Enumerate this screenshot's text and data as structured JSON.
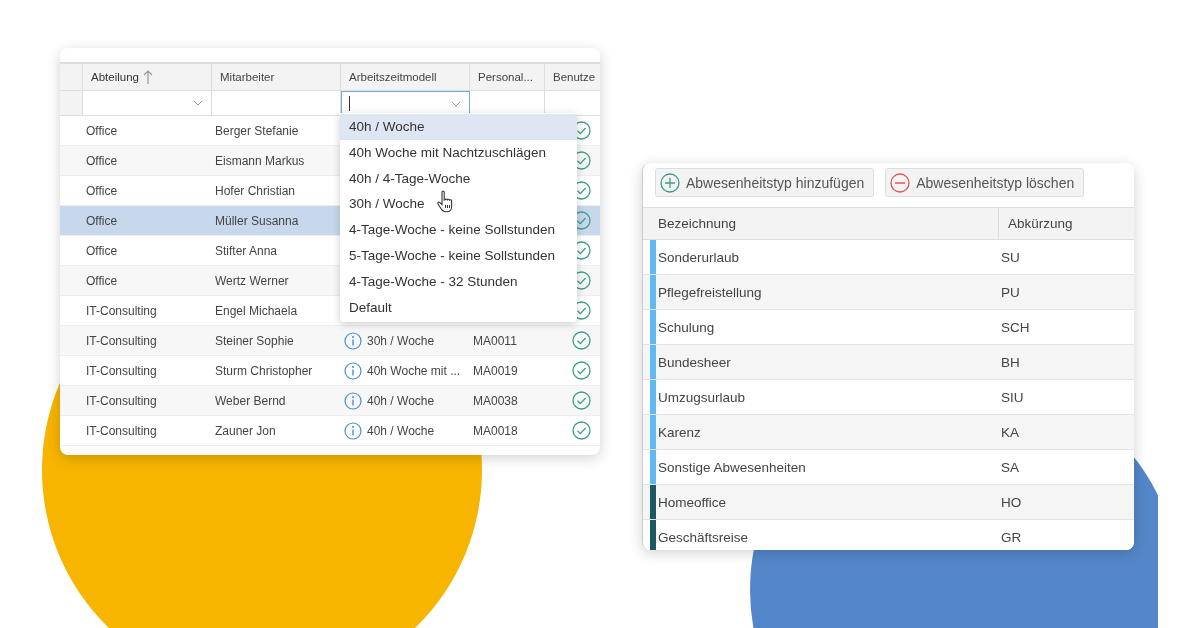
{
  "employee_table": {
    "columns": [
      {
        "label": "Abteilung",
        "sorted": true
      },
      {
        "label": "Mitarbeiter",
        "sorted": false
      },
      {
        "label": "Arbeitszeitmodell",
        "sorted": false
      },
      {
        "label": "Personal...",
        "sorted": false
      },
      {
        "label": "Benutze",
        "sorted": false
      }
    ],
    "rows": [
      {
        "department": "Office",
        "employee": "Berger Stefanie",
        "selected": false
      },
      {
        "department": "Office",
        "employee": "Eismann Markus",
        "selected": false
      },
      {
        "department": "Office",
        "employee": "Hofer Christian",
        "selected": false
      },
      {
        "department": "Office",
        "employee": "Müller Susanna",
        "selected": true
      },
      {
        "department": "Office",
        "employee": "Stifter Anna",
        "selected": false
      },
      {
        "department": "Office",
        "employee": "Wertz Werner",
        "selected": false
      },
      {
        "department": "IT-Consulting",
        "employee": "Engel Michaela",
        "selected": false
      },
      {
        "department": "IT-Consulting",
        "employee": "Steiner Sophie",
        "model": "30h / Woche",
        "personnel_no": "MA0011",
        "selected": false
      },
      {
        "department": "IT-Consulting",
        "employee": "Sturm Christopher",
        "model": "40h Woche mit ...",
        "personnel_no": "MA0019",
        "selected": false
      },
      {
        "department": "IT-Consulting",
        "employee": "Weber Bernd",
        "model": "40h / Woche",
        "personnel_no": "MA0038",
        "selected": false
      },
      {
        "department": "IT-Consulting",
        "employee": "Zauner Jon",
        "model": "40h / Woche",
        "personnel_no": "MA0018",
        "selected": false
      }
    ],
    "model_dropdown": {
      "options": [
        {
          "label": "40h / Woche",
          "selected": true
        },
        {
          "label": "40h Woche mit Nachtzuschlägen",
          "selected": false
        },
        {
          "label": "40h / 4-Tage-Woche",
          "selected": false
        },
        {
          "label": "30h / Woche",
          "selected": false
        },
        {
          "label": "4-Tage-Woche - keine Sollstunden",
          "selected": false
        },
        {
          "label": "5-Tage-Woche - keine Sollstunden",
          "selected": false
        },
        {
          "label": "4-Tage-Woche - 32 Stunden",
          "selected": false
        },
        {
          "label": "Default",
          "selected": false
        }
      ]
    }
  },
  "absence_types": {
    "toolbar": [
      {
        "kind": "add",
        "label": "Abwesenheitstyp hinzufügen"
      },
      {
        "kind": "delete",
        "label": "Abwesenheitstyp löschen"
      }
    ],
    "columns": [
      "Bezeichnung",
      "Abkürzung"
    ],
    "rows": [
      {
        "name": "Sonderurlaub",
        "abbreviation": "SU",
        "color": "#62b8f2"
      },
      {
        "name": "Pflegefreistellung",
        "abbreviation": "PU",
        "color": "#62b8f2"
      },
      {
        "name": "Schulung",
        "abbreviation": "SCH",
        "color": "#62b8f2"
      },
      {
        "name": "Bundesheer",
        "abbreviation": "BH",
        "color": "#62b8f2"
      },
      {
        "name": "Umzugsurlaub",
        "abbreviation": "SIU",
        "color": "#62b8f2"
      },
      {
        "name": "Karenz",
        "abbreviation": "KA",
        "color": "#62b8f2"
      },
      {
        "name": "Sonstige Abwesenheiten",
        "abbreviation": "SA",
        "color": "#62b8f2"
      },
      {
        "name": "Homeoffice",
        "abbreviation": "HO",
        "color": "#1f5865"
      },
      {
        "name": "Geschäftsreise",
        "abbreviation": "GR",
        "color": "#1f5865"
      }
    ]
  }
}
